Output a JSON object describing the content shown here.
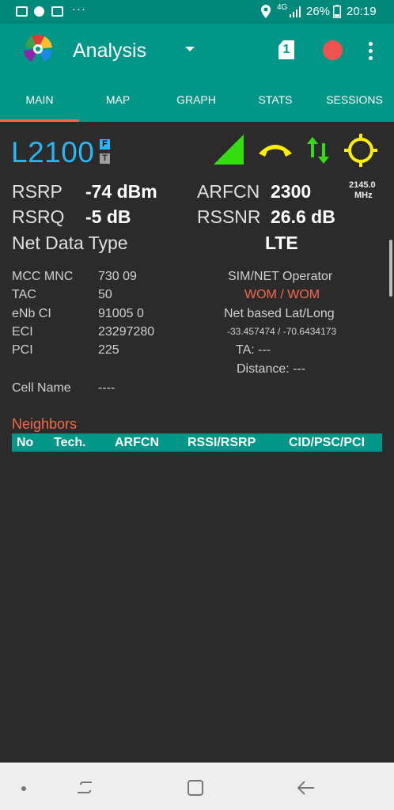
{
  "status_bar": {
    "network": "4G",
    "battery": "26%",
    "time": "20:19"
  },
  "app_bar": {
    "title": "Analysis",
    "sim_slot": "1"
  },
  "tabs": [
    "MAIN",
    "MAP",
    "GRAPH",
    "STATS",
    "SESSIONS"
  ],
  "main": {
    "band": "L2100",
    "band_flag_f": "F",
    "band_flag_t": "T",
    "freq": "2145.0",
    "freq_unit": "MHz",
    "rsrp_label": "RSRP",
    "rsrp_value": "-74 dBm",
    "rsrq_label": "RSRQ",
    "rsrq_value": "-5 dB",
    "arfcn_label": "ARFCN",
    "arfcn_value": "2300",
    "rssnr_label": "RSSNR",
    "rssnr_value": "26.6 dB",
    "net_type_label": "Net Data Type",
    "net_type_value": "LTE",
    "mcc_mnc_label": "MCC MNC",
    "mcc_mnc_value": "730 09",
    "tac_label": "TAC",
    "tac_value": "50",
    "enb_label": "eNb CI",
    "enb_value": "91005 0",
    "eci_label": "ECI",
    "eci_value": "23297280",
    "pci_label": "PCI",
    "pci_value": "225",
    "cell_name_label": "Cell Name",
    "cell_name_value": "----",
    "operator_label": "SIM/NET Operator",
    "operator_value": "WOM / WOM",
    "latlong_label": "Net based Lat/Long",
    "latlong_value": "-33.457474 / -70.6434173",
    "ta": "TA: ---",
    "distance": "Distance: ---"
  },
  "neighbors": {
    "title": "Neighbors",
    "columns": [
      "No",
      "Tech.",
      "ARFCN",
      "RSSI/RSRP",
      "CID/PSC/PCI"
    ]
  },
  "colors": {
    "primary": "#009688",
    "accent": "#f26b4c",
    "band": "#29b6f6",
    "signal": "#33dd11",
    "call": "#ffee00",
    "record": "#ef5350"
  }
}
